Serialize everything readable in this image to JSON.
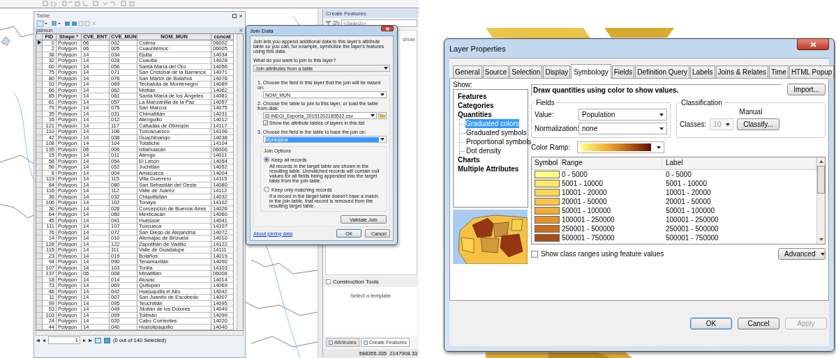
{
  "left_screenshot": {
    "create_features": {
      "title": "Create Features",
      "search_placeholder": "<Search>",
      "hint_fragment": "show"
    },
    "construction_tools": {
      "title": "Construction Tools",
      "hint": "Select a template."
    },
    "bottom_tabs": [
      {
        "label": "Attributes",
        "selected": false
      },
      {
        "label": "Create Features",
        "selected": true
      }
    ],
    "coordinates": "588355.335  2147908.33",
    "table_window": {
      "title": "Table",
      "layer_tab": "jalmun",
      "columns": [
        "FID",
        "Shape *",
        "CVE_ENT",
        "CVE_MUN",
        "NOM_MUN",
        "concat"
      ],
      "rows": [
        {
          "current": true,
          "cells": [
            "0",
            "Polygon",
            "06",
            "002",
            "Colima",
            "06002"
          ]
        },
        {
          "current": false,
          "cells": [
            "2",
            "Polygon",
            "06",
            "005",
            "Cuauhtémoc",
            "06005"
          ]
        },
        {
          "current": false,
          "cells": [
            "38",
            "Polygon",
            "14",
            "034",
            "Ejutla",
            "14034"
          ]
        },
        {
          "current": false,
          "cells": [
            "32",
            "Polygon",
            "14",
            "028",
            "Cuautla",
            "14028"
          ]
        },
        {
          "current": false,
          "cells": [
            "60",
            "Polygon",
            "14",
            "056",
            "Santa María del Oro",
            "14056"
          ]
        },
        {
          "current": false,
          "cells": [
            "75",
            "Polygon",
            "14",
            "071",
            "San Cristóbal de la Barranca",
            "14071"
          ]
        },
        {
          "current": false,
          "cells": [
            "80",
            "Polygon",
            "14",
            "076",
            "San Martín de Bolaños",
            "14076"
          ]
        },
        {
          "current": false,
          "cells": [
            "93",
            "Polygon",
            "14",
            "089",
            "Techaluta de Montenegro",
            "14089"
          ]
        },
        {
          "current": false,
          "cells": [
            "66",
            "Polygon",
            "14",
            "062",
            "Mixtlán",
            "14062"
          ]
        },
        {
          "current": false,
          "cells": [
            "85",
            "Polygon",
            "14",
            "081",
            "Santa María de los Ángeles",
            "14081"
          ]
        },
        {
          "current": false,
          "cells": [
            "61",
            "Polygon",
            "14",
            "057",
            "La Manzanilla de la Paz",
            "14057"
          ]
        },
        {
          "current": false,
          "cells": [
            "79",
            "Polygon",
            "14",
            "075",
            "San Marcos",
            "14075"
          ]
        },
        {
          "current": false,
          "cells": [
            "35",
            "Polygon",
            "14",
            "031",
            "Chimaltitán",
            "14031"
          ]
        },
        {
          "current": false,
          "cells": [
            "16",
            "Polygon",
            "14",
            "012",
            "Atenguillo",
            "14012"
          ]
        },
        {
          "current": false,
          "cells": [
            "121",
            "Polygon",
            "14",
            "117",
            "Cañadas de Obregón",
            "14117"
          ]
        },
        {
          "current": false,
          "cells": [
            "110",
            "Polygon",
            "14",
            "106",
            "Tuxcacuesco",
            "14106"
          ]
        },
        {
          "current": false,
          "cells": [
            "42",
            "Polygon",
            "14",
            "038",
            "Guachinango",
            "14038"
          ]
        },
        {
          "current": false,
          "cells": [
            "108",
            "Polygon",
            "14",
            "104",
            "Totatiche",
            "14104"
          ]
        },
        {
          "current": false,
          "cells": [
            "135",
            "Polygon",
            "06",
            "006",
            "Ixtlahuacán",
            "06006"
          ]
        },
        {
          "current": false,
          "cells": [
            "15",
            "Polygon",
            "14",
            "011",
            "Atengo",
            "14011"
          ]
        },
        {
          "current": false,
          "cells": [
            "58",
            "Polygon",
            "14",
            "054",
            "El Limón",
            "14054"
          ]
        },
        {
          "current": false,
          "cells": [
            "56",
            "Polygon",
            "14",
            "052",
            "Juchitlán",
            "14052"
          ]
        },
        {
          "current": false,
          "cells": [
            "8",
            "Polygon",
            "14",
            "004",
            "Amacueca",
            "14004"
          ]
        },
        {
          "current": false,
          "cells": [
            "119",
            "Polygon",
            "14",
            "115",
            "Villa Guerrero",
            "14115"
          ]
        },
        {
          "current": false,
          "cells": [
            "84",
            "Polygon",
            "14",
            "080",
            "San Sebastián del Oeste",
            "14080"
          ]
        },
        {
          "current": false,
          "cells": [
            "116",
            "Polygon",
            "14",
            "112",
            "Valle de Juárez",
            "14112"
          ]
        },
        {
          "current": false,
          "cells": [
            "36",
            "Polygon",
            "14",
            "032",
            "Chiquilistlán",
            "14032"
          ]
        },
        {
          "current": false,
          "cells": [
            "106",
            "Polygon",
            "14",
            "102",
            "Tonaya",
            "14102"
          ]
        },
        {
          "current": false,
          "cells": [
            "30",
            "Polygon",
            "14",
            "026",
            "Concepción de Buenos Aires",
            "14026"
          ]
        },
        {
          "current": false,
          "cells": [
            "64",
            "Polygon",
            "14",
            "060",
            "Mexticacán",
            "14060"
          ]
        },
        {
          "current": false,
          "cells": [
            "45",
            "Polygon",
            "14",
            "041",
            "Huejúcar",
            "14041"
          ]
        },
        {
          "current": false,
          "cells": [
            "111",
            "Polygon",
            "14",
            "107",
            "Tuxcueca",
            "14107"
          ]
        },
        {
          "current": false,
          "cells": [
            "76",
            "Polygon",
            "14",
            "072",
            "San Diego de Alejandría",
            "14072"
          ]
        },
        {
          "current": false,
          "cells": [
            "14",
            "Polygon",
            "14",
            "010",
            "Atemajac de Brizuela",
            "14010"
          ]
        },
        {
          "current": false,
          "cells": [
            "126",
            "Polygon",
            "14",
            "122",
            "Zapotitlán de Vadillo",
            "14122"
          ]
        },
        {
          "current": false,
          "cells": [
            "115",
            "Polygon",
            "14",
            "111",
            "Valle de Guadalupe",
            "14111"
          ]
        },
        {
          "current": false,
          "cells": [
            "23",
            "Polygon",
            "14",
            "019",
            "Bolaños",
            "14019"
          ]
        },
        {
          "current": false,
          "cells": [
            "94",
            "Polygon",
            "14",
            "090",
            "Tenamaxtlán",
            "14090"
          ]
        },
        {
          "current": false,
          "cells": [
            "107",
            "Polygon",
            "14",
            "103",
            "Tonila",
            "14103"
          ]
        },
        {
          "current": false,
          "cells": [
            "137",
            "Polygon",
            "06",
            "008",
            "Minatitlán",
            "06008"
          ]
        },
        {
          "current": false,
          "cells": [
            "18",
            "Polygon",
            "14",
            "014",
            "Atoyac",
            "14014"
          ]
        },
        {
          "current": false,
          "cells": [
            "73",
            "Polygon",
            "14",
            "069",
            "Quitupan",
            "14069"
          ]
        },
        {
          "current": false,
          "cells": [
            "46",
            "Polygon",
            "14",
            "042",
            "Huejuquilla el Alto",
            "14042"
          ]
        },
        {
          "current": false,
          "cells": [
            "11",
            "Polygon",
            "14",
            "007",
            "San Juanito de Escobedo",
            "14007"
          ]
        },
        {
          "current": false,
          "cells": [
            "99",
            "Polygon",
            "14",
            "095",
            "Teuchitlán",
            "14095"
          ]
        },
        {
          "current": false,
          "cells": [
            "53",
            "Polygon",
            "14",
            "049",
            "Jilotlán de los Dolores",
            "14049"
          ]
        },
        {
          "current": false,
          "cells": [
            "103",
            "Polygon",
            "14",
            "099",
            "Tolimán",
            "14099"
          ]
        },
        {
          "current": false,
          "cells": [
            "24",
            "Polygon",
            "14",
            "020",
            "Cabo Corrientes",
            "14020"
          ]
        },
        {
          "current": false,
          "cells": [
            "44",
            "Polygon",
            "14",
            "040",
            "Hostotipaquillo",
            "14040"
          ]
        }
      ],
      "record": "1",
      "selection_status": "(0 out of 140 Selected)"
    },
    "join_dialog": {
      "title": "Join Data",
      "intro": "Join lets you append additional data to this layer's attribute table so you can, for example, symbolize the layer's features using this data.",
      "question": "What do you want to join to this layer?",
      "join_type": "Join attributes from a table",
      "step_1": {
        "label": "1.  Choose the field in this layer that the join will be based on:",
        "value": "NOM_MUN"
      },
      "step_2": {
        "label": "2.  Choose the table to join to this layer, or load the table from disk:",
        "value": "INEGI_Exporta_20151202185522.csv",
        "checkbox_label": "Show the attribute tables of layers in this list",
        "checked": true
      },
      "step_3": {
        "label": "3.  Choose the field in the table to base the join on:",
        "value": "Municipios"
      },
      "join_options_title": "Join Options",
      "join_options": [
        {
          "label": "Keep all records",
          "selected": true,
          "description": "All records in the target table are shown in the resulting table. Unmatched records will contain null values for all fields being appended into the target table from the join table."
        },
        {
          "label": "Keep only matching records",
          "selected": false,
          "description": "If a record in the target table doesn't have a match in the join table, that record is removed from the resulting target table."
        }
      ],
      "validate_button": "Validate Join",
      "help_link": "About joining data",
      "buttons": [
        "OK",
        "Cancel"
      ]
    }
  },
  "layer_properties": {
    "title": "Layer Properties",
    "tabs": [
      {
        "label": "General",
        "selected": false
      },
      {
        "label": "Source",
        "selected": false
      },
      {
        "label": "Selection",
        "selected": false
      },
      {
        "label": "Display",
        "selected": false
      },
      {
        "label": "Symbology",
        "selected": true
      },
      {
        "label": "Fields",
        "selected": false
      },
      {
        "label": "Definition Query",
        "selected": false
      },
      {
        "label": "Labels",
        "selected": false
      },
      {
        "label": "Joins & Relates",
        "selected": false
      },
      {
        "label": "Time",
        "selected": false
      },
      {
        "label": "HTML Popup",
        "selected": false
      }
    ],
    "show_label": "Show:",
    "show_tree": [
      {
        "label": "Features",
        "selected": false
      },
      {
        "label": "Categories",
        "selected": false
      },
      {
        "label": "Quantities",
        "selected": false,
        "children": [
          {
            "label": "Graduated colors",
            "selected": true
          },
          {
            "label": "Graduated symbols",
            "selected": false
          },
          {
            "label": "Proportional symbols",
            "selected": false
          },
          {
            "label": "Dot density",
            "selected": false
          }
        ]
      },
      {
        "label": "Charts",
        "selected": false
      },
      {
        "label": "Multiple Attributes",
        "selected": false
      }
    ],
    "description": "Draw quantities using color to show values.",
    "import_button": "Import...",
    "fields": {
      "title": "Fields",
      "value_label": "Value:",
      "value": "Population",
      "normalization_label": "Normalization:",
      "normalization": "none"
    },
    "classification": {
      "title": "Classification",
      "method": "Manual",
      "classes_label": "Classes:",
      "classes": "10",
      "classes_disabled": true,
      "classify_button": "Classify..."
    },
    "color_ramp_label": "Color Ramp:",
    "class_table": {
      "columns": [
        "Symbol",
        "Range",
        "Label"
      ],
      "rows": [
        {
          "color": "#ffff80",
          "range": "0 - 5000",
          "label": "0 - 5000"
        },
        {
          "color": "#fde86a",
          "range": "5001 - 10000",
          "label": "5001 - 10000"
        },
        {
          "color": "#fbd65a",
          "range": "10001 - 20000",
          "label": "10001 - 20000"
        },
        {
          "color": "#f8c44c",
          "range": "20001 - 50000",
          "label": "20001 - 50000"
        },
        {
          "color": "#f2ac38",
          "range": "50001 - 100000",
          "label": "50001 - 100000"
        },
        {
          "color": "#e4932c",
          "range": "100001 - 250000",
          "label": "100001 - 250000"
        },
        {
          "color": "#c86c1e",
          "range": "250001 - 500000",
          "label": "250001 - 500000"
        },
        {
          "color": "#a84c14",
          "range": "500001 - 750000",
          "label": "500001 - 750000"
        }
      ]
    },
    "feature_values_checkbox": {
      "label": "Show class ranges using feature values",
      "checked": false
    },
    "advanced_button": "Advanced",
    "buttons": [
      {
        "label": "OK",
        "disabled": false
      },
      {
        "label": "Cancel",
        "disabled": false
      },
      {
        "label": "Apply",
        "disabled": true
      }
    ]
  }
}
